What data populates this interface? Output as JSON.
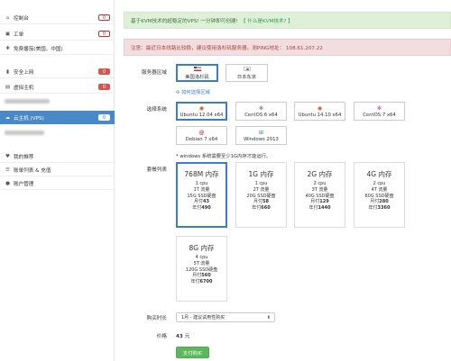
{
  "sidebar": {
    "items": [
      {
        "label": "控制台",
        "icon": "home-icon",
        "badge": "0"
      },
      {
        "label": "工单",
        "icon": "ticket-icon",
        "badge": "0"
      },
      {
        "label": "免费番茄(美国、中国)",
        "icon": "gift-icon"
      },
      {
        "label": "安全上网",
        "icon": "shield-icon",
        "badge": "0"
      },
      {
        "label": "虚拟主机",
        "icon": "server-icon",
        "badge": "0"
      },
      {
        "label": "云主机 (VPS)",
        "icon": "cloud-icon",
        "badge": "0"
      },
      {
        "label": "我的推荐",
        "icon": "thumbs-up-icon"
      },
      {
        "label": "账单列表 & 充值",
        "icon": "bill-icon"
      },
      {
        "label": "账户管理",
        "icon": "user-icon"
      }
    ]
  },
  "alerts": {
    "success_text": "基于KVM技术的超稳定的VPS! 一分钟即可创建!",
    "success_link": "【 什么是KVM技术? 】",
    "danger_text": "注意：最近日本线路比较稳，建议使用洛杉矶服务器。测PING地址： 108.61.207.22"
  },
  "region": {
    "label": "服务器区域",
    "options": [
      {
        "name": "美国洛杉矶",
        "selected": true
      },
      {
        "name": "日本东京",
        "selected": false
      }
    ],
    "compare_link": "如何选择区域"
  },
  "os": {
    "label": "选择系统",
    "options": [
      {
        "name": "Ubuntu 12.04 x64",
        "icon": "ubuntu-icon",
        "selected": true
      },
      {
        "name": "CentOS 6 x64",
        "icon": "centos-icon",
        "selected": false
      },
      {
        "name": "Ubuntu 14.10 x64",
        "icon": "ubuntu-icon",
        "selected": false
      },
      {
        "name": "CentOS 7 x64",
        "icon": "centos-icon",
        "selected": false
      },
      {
        "name": "Debian 7 x64",
        "icon": "debian-icon",
        "selected": false
      },
      {
        "name": "Windows 2013",
        "icon": "windows-icon",
        "selected": false
      }
    ],
    "note": "* windows 系统需要至少1G内存才能运行。"
  },
  "plans": {
    "label": "套餐列表",
    "items": [
      {
        "title": "768M 内存",
        "cpu": "1 cpu",
        "traffic": "1T 流量",
        "disk": "15G SSD硬盘",
        "monthly_prefix": "月付",
        "monthly": "43",
        "yearly_prefix": "年付",
        "yearly": "490",
        "selected": true
      },
      {
        "title": "1G 内存",
        "cpu": "1 cpu",
        "traffic": "2T 流量",
        "disk": "20G SSD硬盘",
        "monthly_prefix": "月付",
        "monthly": "58",
        "yearly_prefix": "年付",
        "yearly": "660",
        "selected": false
      },
      {
        "title": "2G 内存",
        "cpu": "2 cpu",
        "traffic": "3T 流量",
        "disk": "40G SSD硬盘",
        "monthly_prefix": "月付",
        "monthly": "129",
        "yearly_prefix": "年付",
        "yearly": "1440",
        "selected": false
      },
      {
        "title": "4G 内存",
        "cpu": "2 cpu",
        "traffic": "4T 流量",
        "disk": "60G SSD硬盘",
        "monthly_prefix": "月付",
        "monthly": "280",
        "yearly_prefix": "年付",
        "yearly": "3360",
        "selected": false
      },
      {
        "title": "8G 内存",
        "cpu": "4 cpu",
        "traffic": "5T 流量",
        "disk": "120G SSD硬盘",
        "monthly_prefix": "月付",
        "monthly": "560",
        "yearly_prefix": "年付",
        "yearly": "6700",
        "selected": false
      }
    ]
  },
  "duration": {
    "label": "购买时长",
    "value": "1月 - 建议试用性购买"
  },
  "price": {
    "label": "价格",
    "value": "43",
    "unit": "元"
  },
  "buy_button": "支付购买"
}
